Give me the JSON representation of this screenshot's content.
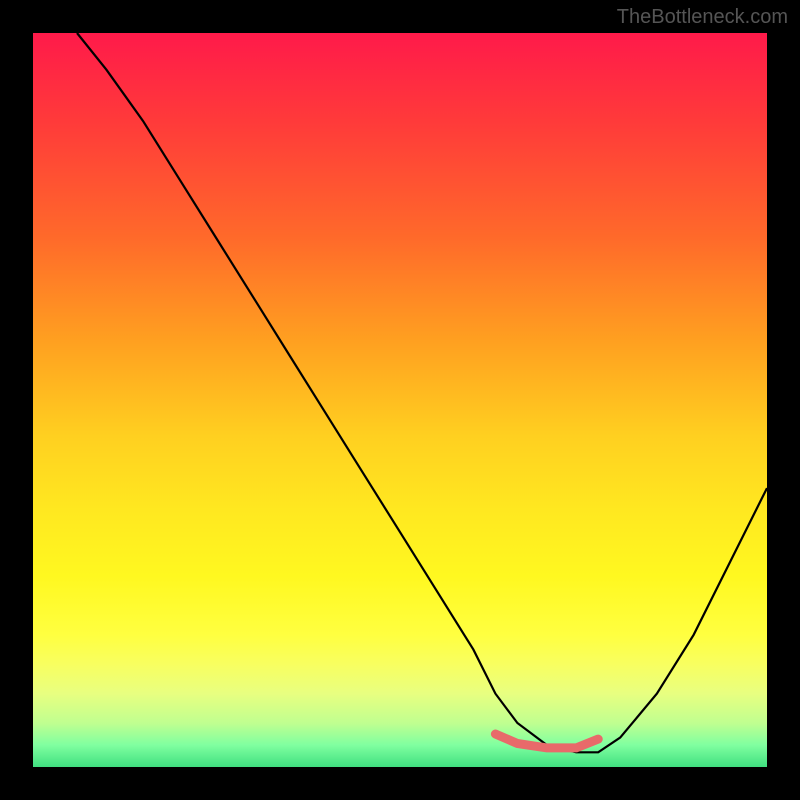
{
  "watermark": "TheBottleneck.com",
  "chart_data": {
    "type": "line",
    "title": "",
    "xlabel": "",
    "ylabel": "",
    "xlim": [
      0,
      100
    ],
    "ylim": [
      0,
      100
    ],
    "series": [
      {
        "name": "bottleneck-curve",
        "x": [
          6,
          10,
          15,
          20,
          25,
          30,
          35,
          40,
          45,
          50,
          55,
          60,
          63,
          66,
          70,
          74,
          77,
          80,
          85,
          90,
          95,
          100
        ],
        "values": [
          100,
          95,
          88,
          80,
          72,
          64,
          56,
          48,
          40,
          32,
          24,
          16,
          10,
          6,
          3,
          2,
          2,
          4,
          10,
          18,
          28,
          38
        ]
      },
      {
        "name": "optimal-zone",
        "x": [
          63,
          66,
          70,
          74,
          77
        ],
        "values": [
          4.5,
          3.2,
          2.6,
          2.6,
          3.8
        ]
      }
    ],
    "gradient_stops": [
      {
        "pos": 0,
        "color": "#ff1a4a"
      },
      {
        "pos": 28,
        "color": "#ff6a2a"
      },
      {
        "pos": 55,
        "color": "#ffd020"
      },
      {
        "pos": 82,
        "color": "#ffff40"
      },
      {
        "pos": 100,
        "color": "#40e080"
      }
    ]
  }
}
